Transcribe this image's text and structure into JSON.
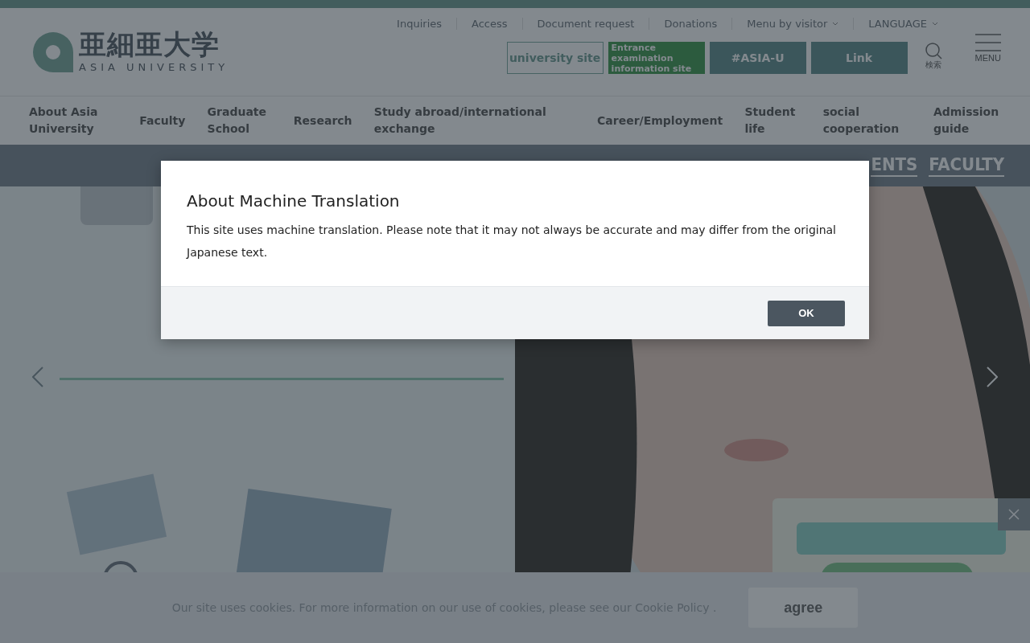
{
  "logo": {
    "kanji": "亜細亜大学",
    "latin": "ASIA UNIVERSITY"
  },
  "utility_links": [
    {
      "label": "Inquiries",
      "dropdown": false
    },
    {
      "label": "Access",
      "dropdown": false
    },
    {
      "label": "Document request",
      "dropdown": false
    },
    {
      "label": "Donations",
      "dropdown": false
    },
    {
      "label": "Menu by visitor",
      "dropdown": true
    },
    {
      "label": "LANGUAGE",
      "dropdown": true
    }
  ],
  "site_buttons": [
    {
      "label": "university site",
      "kind": "outline"
    },
    {
      "label": "Entrance examination information site",
      "kind": "green"
    },
    {
      "label": "#ASIA-U",
      "kind": "teal"
    },
    {
      "label": "Link",
      "kind": "teal"
    }
  ],
  "search": {
    "label": "検索"
  },
  "menu": {
    "label": "MENU"
  },
  "nav": [
    "About Asia University",
    "Faculty",
    "Graduate School",
    "Research",
    "Study abroad/international exchange",
    "Career/Employment",
    "Student life",
    "social cooperation",
    "Admission guide"
  ],
  "hero_tabs": [
    {
      "label": "ENTS",
      "selected": true
    },
    {
      "label": "FACULTY",
      "selected": true
    }
  ],
  "cookie_bar": {
    "text": "Our site uses cookies. For more information on our use of cookies, please see our",
    "link": "Cookie Policy",
    "after": ".",
    "button": "agree"
  },
  "modal": {
    "title": "About Machine Translation",
    "body": "This site uses machine translation. Please note that it may not always be accurate and may differ from the original Japanese text.",
    "button": "OK"
  }
}
